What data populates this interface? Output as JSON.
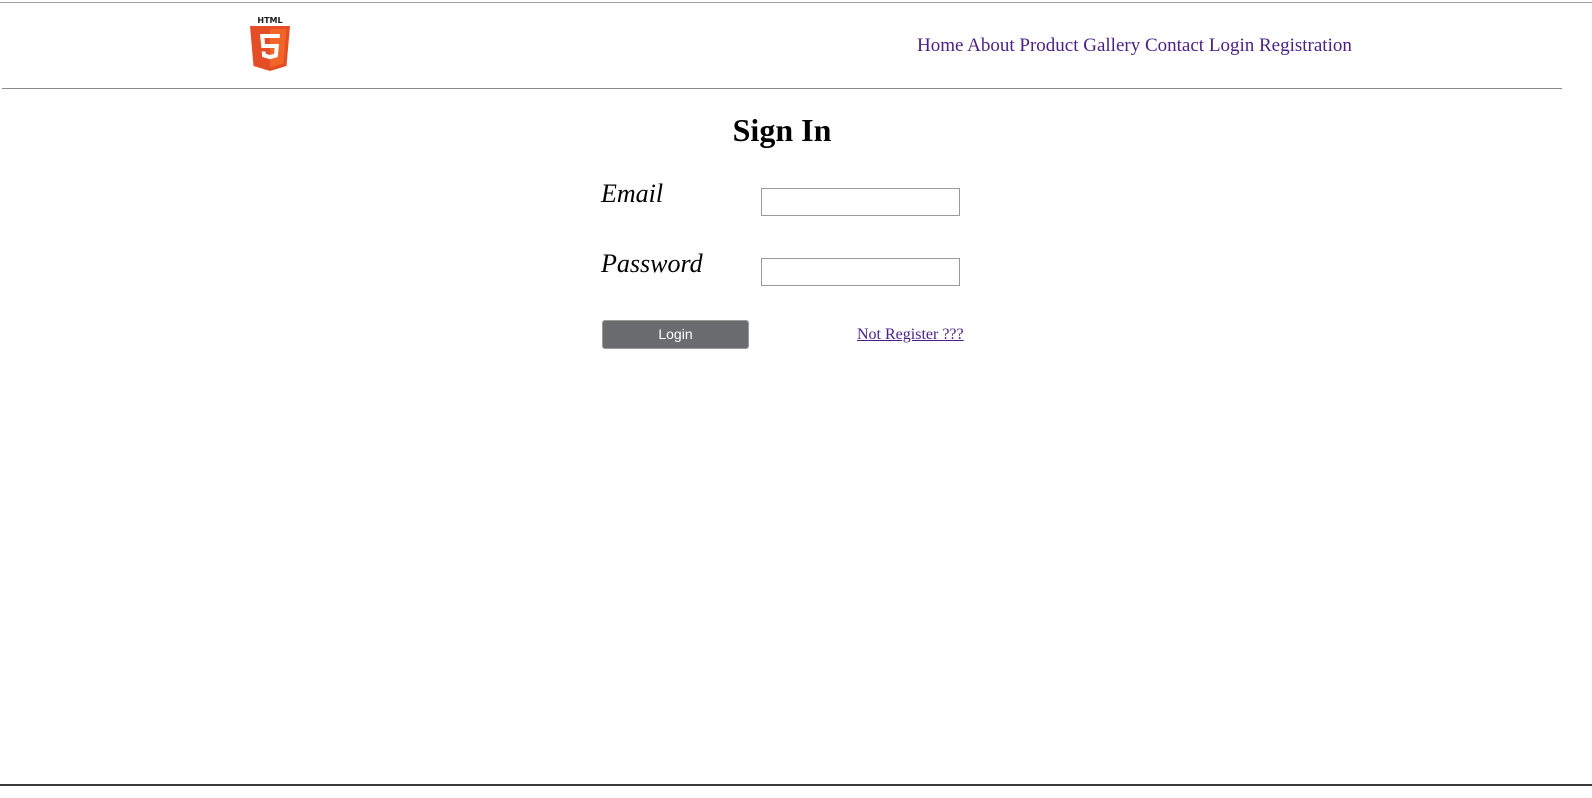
{
  "header": {
    "logo": {
      "icon": "html5-logo-icon",
      "text": "HTML",
      "color": "#e44d26"
    },
    "nav": [
      {
        "label": "Home"
      },
      {
        "label": "About"
      },
      {
        "label": "Product"
      },
      {
        "label": "Gallery"
      },
      {
        "label": "Contact"
      },
      {
        "label": "Login"
      },
      {
        "label": "Registration"
      }
    ],
    "link_color": "#4b1f86"
  },
  "main": {
    "title": "Sign In",
    "form": {
      "email_label": "Email",
      "email_value": "",
      "password_label": "Password",
      "password_value": "",
      "login_button": "Login",
      "register_link": "Not Register ???"
    },
    "button_color": "#6a6c6f"
  }
}
